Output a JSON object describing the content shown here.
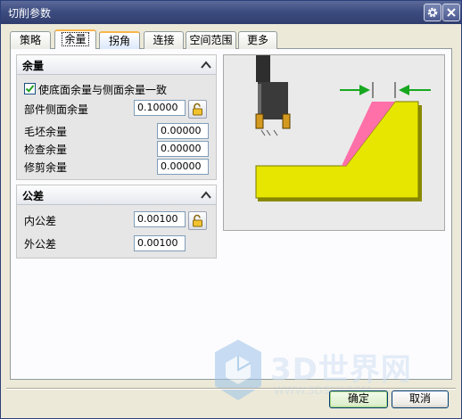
{
  "window": {
    "title": "切削参数"
  },
  "tabs": [
    {
      "label": "策略"
    },
    {
      "label": "余量"
    },
    {
      "label": "拐角"
    },
    {
      "label": "连接"
    },
    {
      "label": "空间范围"
    },
    {
      "label": "更多"
    }
  ],
  "active_tab": "余量",
  "stock_panel": {
    "title": "余量",
    "checkbox_label": "使底面余量与侧面余量一致",
    "checkbox_checked": true,
    "part_side_stock": {
      "label": "部件侧面余量",
      "value": "0.10000"
    },
    "blank_stock": {
      "label": "毛坯余量",
      "value": "0.00000"
    },
    "check_stock": {
      "label": "检查余量",
      "value": "0.00000"
    },
    "trim_stock": {
      "label": "修剪余量",
      "value": "0.00000"
    }
  },
  "tolerance_panel": {
    "title": "公差",
    "intol": {
      "label": "内公差",
      "value": "0.00100"
    },
    "outtol": {
      "label": "外公差",
      "value": "0.00100"
    }
  },
  "buttons": {
    "ok": "确定",
    "cancel": "取消"
  },
  "watermark": {
    "text": "3D世界网",
    "sub": "WWW.3DSJW.COM"
  },
  "colors": {
    "part_fill": "#e6e600",
    "stock_fill": "#ff6fa8",
    "arrow": "#18a820",
    "tool": "#3a3a3a"
  },
  "icons": [
    "gear-icon",
    "close-icon",
    "chevron-up-icon",
    "lock-icon",
    "checkmark-icon"
  ]
}
